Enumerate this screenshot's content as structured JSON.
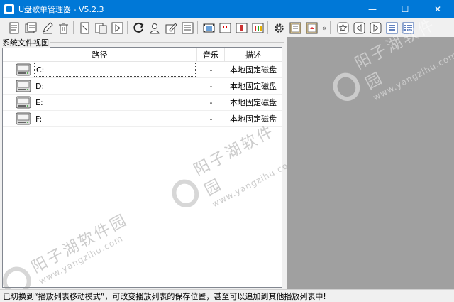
{
  "window": {
    "title": "U盘歌单管理器  - V5.2.3",
    "min_label": "—",
    "max_label": "☐",
    "close_label": "✕"
  },
  "toolbar": {
    "left_icons": [
      "new-list-icon",
      "save-list-icon",
      "edit-icon",
      "delete-icon",
      "copy-icon",
      "paste-icon",
      "play-icon",
      "refresh-icon",
      "user-icon",
      "rename-icon",
      "list-view-icon",
      "film-icon",
      "caption-icon",
      "column-icon",
      "color-bars-icon",
      "settings-icon",
      "notes-icon",
      "export-icon"
    ],
    "overflow_label": "«",
    "right_icons": [
      "favorite-icon",
      "back-icon",
      "forward-icon",
      "details-icon",
      "list-detail-icon"
    ]
  },
  "panel": {
    "title": "系统文件视图",
    "columns": {
      "path": "路径",
      "music": "音乐",
      "desc": "描述"
    },
    "rows": [
      {
        "path": "C:",
        "music": "-",
        "desc": "本地固定磁盘"
      },
      {
        "path": "D:",
        "music": "-",
        "desc": "本地固定磁盘"
      },
      {
        "path": "E:",
        "music": "-",
        "desc": "本地固定磁盘"
      },
      {
        "path": "F:",
        "music": "-",
        "desc": "本地固定磁盘"
      }
    ]
  },
  "status": {
    "text": "已切换到“播放列表移动模式”，可改变播放列表的保存位置，甚至可以追加到其他播放列表中!"
  },
  "watermark": {
    "cn": "阳子湖软件园",
    "url": "www.yangzihu.com"
  }
}
